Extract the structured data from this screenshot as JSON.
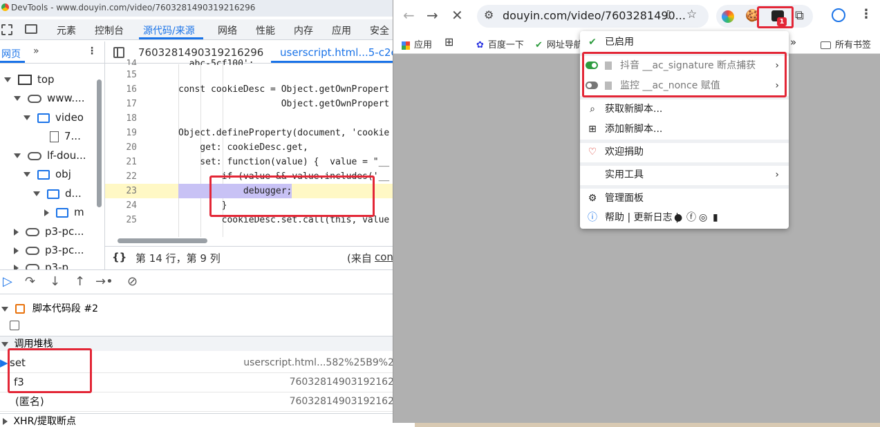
{
  "devtools": {
    "title": "DevTools - www.douyin.com/video/7603281490319216296",
    "tabs": [
      "元素",
      "控制台",
      "源代码/来源",
      "网络",
      "性能",
      "内存",
      "应用",
      "安全"
    ],
    "active_tab": "源代码/来源",
    "left_panel": {
      "tab": "网页",
      "more": "»",
      "menu": "⋮",
      "tree": [
        "top",
        "www....",
        "video",
        "7...",
        "lf-dou...",
        "obj",
        "d...",
        "m",
        "p3-pc...",
        "p3-pc...",
        "p3-p..."
      ]
    },
    "editor": {
      "tabs": [
        "7603281490319216296",
        "userscript.html...5-c2e8"
      ],
      "lines": [
        {
          "n": "14",
          "code": "  abc-5cf100';"
        },
        {
          "n": "15",
          "code": ""
        },
        {
          "n": "16",
          "code": "const cookieDesc = Object.getOwnPropert"
        },
        {
          "n": "17",
          "code": "                   Object.getOwnPropert"
        },
        {
          "n": "18",
          "code": ""
        },
        {
          "n": "19",
          "code": "Object.defineProperty(document, 'cookie"
        },
        {
          "n": "20",
          "code": "    get: cookieDesc.get,"
        },
        {
          "n": "21",
          "code": "    set: function(value) {  value = \"__"
        },
        {
          "n": "22",
          "code": "        if (value && value.includes('__"
        },
        {
          "n": "23",
          "code": "            debugger;"
        },
        {
          "n": "24",
          "code": "        }"
        },
        {
          "n": "25",
          "code": "        cookieDesc.set.call(this, value"
        }
      ],
      "status": "第 14 行，第 9 列",
      "status_right_prefix": "(来自",
      "status_right_link": "con",
      "braces": "{}"
    },
    "debugger": {
      "snippet_label": "脚本代码段 #2",
      "call_stack_label": "调用堆栈",
      "frames": [
        {
          "name": "set",
          "location": "userscript.html...582%25B9%2"
        },
        {
          "name": "f3",
          "location": "76032814903192162"
        },
        {
          "name": "(匿名)",
          "location": "76032814903192162"
        }
      ],
      "xhr_label": "XHR/提取断点"
    }
  },
  "chrome": {
    "url": "douyin.com/video/7603281490...",
    "extension_badge": "1",
    "bookmarks": [
      "应用",
      "百度一下",
      "网址导航",
      "所有书签"
    ],
    "bookmarks_more": "»",
    "menu": {
      "enabled": "已启用",
      "scripts": [
        {
          "name": "抖音 __ac_signature 断点捕获",
          "enabled": true
        },
        {
          "name": "监控 __ac_nonce 赋值",
          "enabled": false
        }
      ],
      "get_scripts": "获取新脚本...",
      "add_script": "添加新脚本...",
      "donate": "欢迎捐助",
      "utilities": "实用工具",
      "dashboard": "管理面板",
      "footer": "帮助 | 更新日志 |"
    }
  }
}
